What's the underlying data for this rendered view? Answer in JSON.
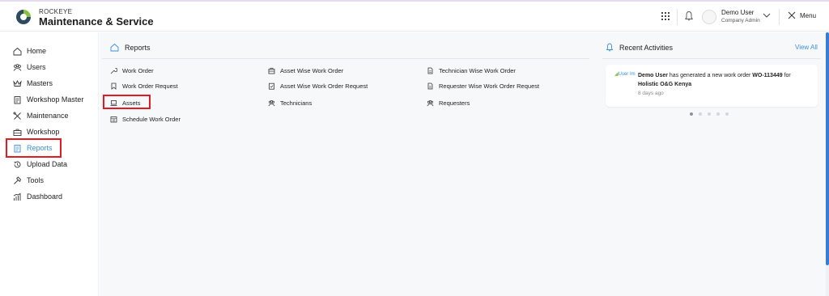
{
  "header": {
    "brand_small": "ROCKEYE",
    "brand_big": "Maintenance & Service",
    "user_name": "Demo User",
    "user_role": "Company Admin",
    "menu_label": "Menu"
  },
  "sidebar": {
    "items": [
      {
        "label": "Home",
        "icon": "home-icon"
      },
      {
        "label": "Users",
        "icon": "users-icon"
      },
      {
        "label": "Masters",
        "icon": "crown-icon"
      },
      {
        "label": "Workshop Master",
        "icon": "clipboard-icon"
      },
      {
        "label": "Maintenance",
        "icon": "tools-icon"
      },
      {
        "label": "Workshop",
        "icon": "toolbox-icon"
      },
      {
        "label": "Reports",
        "icon": "report-icon",
        "active": true
      },
      {
        "label": "Upload Data",
        "icon": "history-icon"
      },
      {
        "label": "Tools",
        "icon": "hammer-icon"
      },
      {
        "label": "Dashboard",
        "icon": "chart-icon"
      }
    ]
  },
  "reports": {
    "title": "Reports",
    "col1": [
      "Work Order",
      "Work Order Request",
      "Assets",
      "Schedule Work Order"
    ],
    "col2": [
      "Asset Wise Work Order",
      "Asset Wise Work Order Request",
      "Technicians"
    ],
    "col3": [
      "Technician Wise Work Order",
      "Requester Wise Work Order Request",
      "Requesters"
    ]
  },
  "recent": {
    "title": "Recent Activities",
    "view_all": "View All",
    "card": {
      "img_alt": "User Im",
      "user": "Demo User",
      "text_mid": " has generated a new work order ",
      "order": "WO-113449",
      "text_for": " for ",
      "client": "Holistic O&G Kenya",
      "time": "8 days ago"
    },
    "dots": 5,
    "active_dot": 0
  },
  "colors": {
    "accent": "#3a8fd8",
    "highlight": "#e21b23",
    "scrollbar": "#3a7bd5"
  }
}
